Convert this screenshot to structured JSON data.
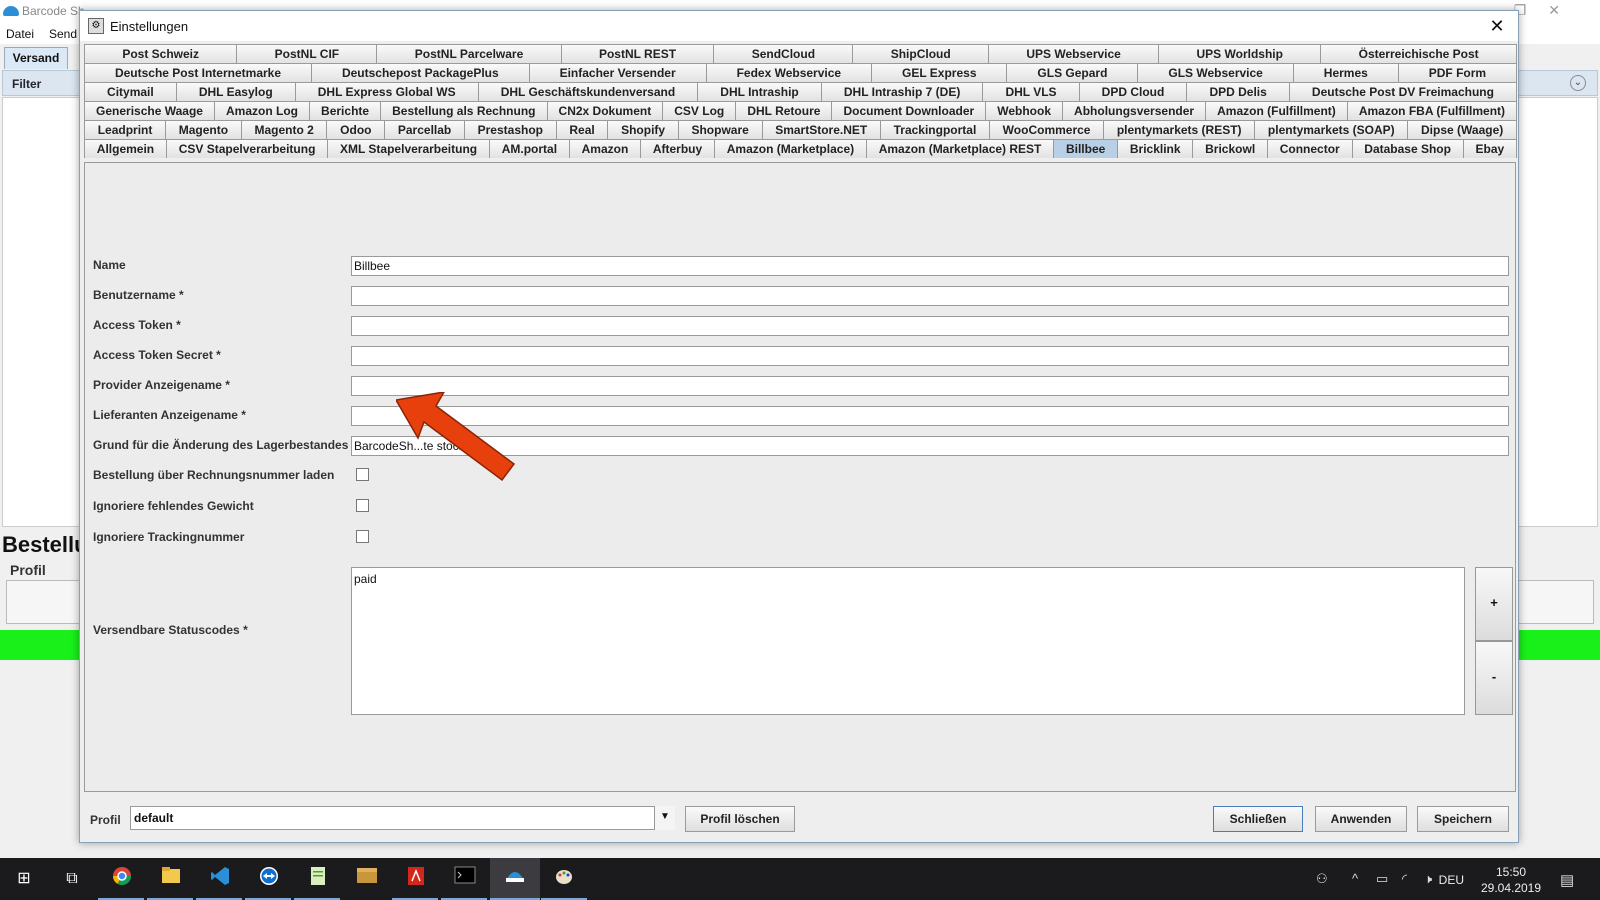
{
  "background_app": {
    "title": "Barcode Sh...",
    "menu": [
      "Datei",
      "Send"
    ],
    "tab": "Versand",
    "filter_label": "Filter",
    "heading": "Bestellu",
    "profil_label": "Profil"
  },
  "dialog": {
    "title": "Einstellungen",
    "tab_rows": [
      [
        "Post Schweiz",
        "PostNL CIF",
        "PostNL Parcelware",
        "PostNL REST",
        "SendCloud",
        "ShipCloud",
        "UPS Webservice",
        "UPS Worldship",
        "Österreichische Post"
      ],
      [
        "Deutsche Post Internetmarke",
        "Deutschepost PackagePlus",
        "Einfacher Versender",
        "Fedex Webservice",
        "GEL Express",
        "GLS Gepard",
        "GLS Webservice",
        "Hermes",
        "PDF Form"
      ],
      [
        "Citymail",
        "DHL Easylog",
        "DHL Express Global WS",
        "DHL Geschäftskundenversand",
        "DHL Intraship",
        "DHL Intraship 7 (DE)",
        "DHL VLS",
        "DPD Cloud",
        "DPD Delis",
        "Deutsche Post DV Freimachung"
      ],
      [
        "Generische Waage",
        "Amazon Log",
        "Berichte",
        "Bestellung als Rechnung",
        "CN2x Dokument",
        "CSV Log",
        "DHL Retoure",
        "Document Downloader",
        "Webhook",
        "Abholungsversender",
        "Amazon (Fulfillment)",
        "Amazon FBA (Fulfillment)"
      ],
      [
        "Leadprint",
        "Magento",
        "Magento 2",
        "Odoo",
        "Parcellab",
        "Prestashop",
        "Real",
        "Shopify",
        "Shopware",
        "SmartStore.NET",
        "Trackingportal",
        "WooCommerce",
        "plentymarkets (REST)",
        "plentymarkets (SOAP)",
        "Dipse (Waage)"
      ],
      [
        "Allgemein",
        "CSV Stapelverarbeitung",
        "XML Stapelverarbeitung",
        "AM.portal",
        "Amazon",
        "Afterbuy",
        "Amazon (Marketplace)",
        "Amazon (Marketplace) REST",
        "Billbee",
        "Bricklink",
        "Brickowl",
        "Connector",
        "Database Shop",
        "Ebay"
      ]
    ],
    "active_tab": "Billbee",
    "fields": {
      "name_label": "Name",
      "name_value": "Billbee",
      "benutzername_label": "Benutzername *",
      "benutzername_value": "",
      "access_token_label": "Access Token *",
      "access_token_value": "",
      "access_token_secret_label": "Access Token Secret *",
      "access_token_secret_value": "",
      "provider_label": "Provider Anzeigename *",
      "provider_value": "",
      "lieferanten_label": "Lieferanten Anzeigename *",
      "lieferanten_value": "",
      "grund_label": "Grund für die Änderung des Lagerbestandes",
      "grund_value": "BarcodeSh...te stock",
      "bestellung_label": "Bestellung über Rechnungsnummer laden",
      "gewicht_label": "Ignoriere fehlendes Gewicht",
      "tracking_label": "Ignoriere Trackingnummer",
      "statuscodes_label": "Versendbare Statuscodes *",
      "statuscodes_value": "paid",
      "add_label": "+",
      "remove_label": "-"
    },
    "bottom": {
      "profil_label": "Profil",
      "profil_value": "default",
      "delete_label": "Profil löschen",
      "close_label": "Schließen",
      "apply_label": "Anwenden",
      "save_label": "Speichern"
    }
  },
  "taskbar": {
    "language": "DEU",
    "time": "15:50",
    "date": "29.04.2019"
  },
  "colors": {
    "active_tab": "#b8cfe5",
    "annotation_arrow": "#e8400c",
    "status_green": "#19f019"
  }
}
